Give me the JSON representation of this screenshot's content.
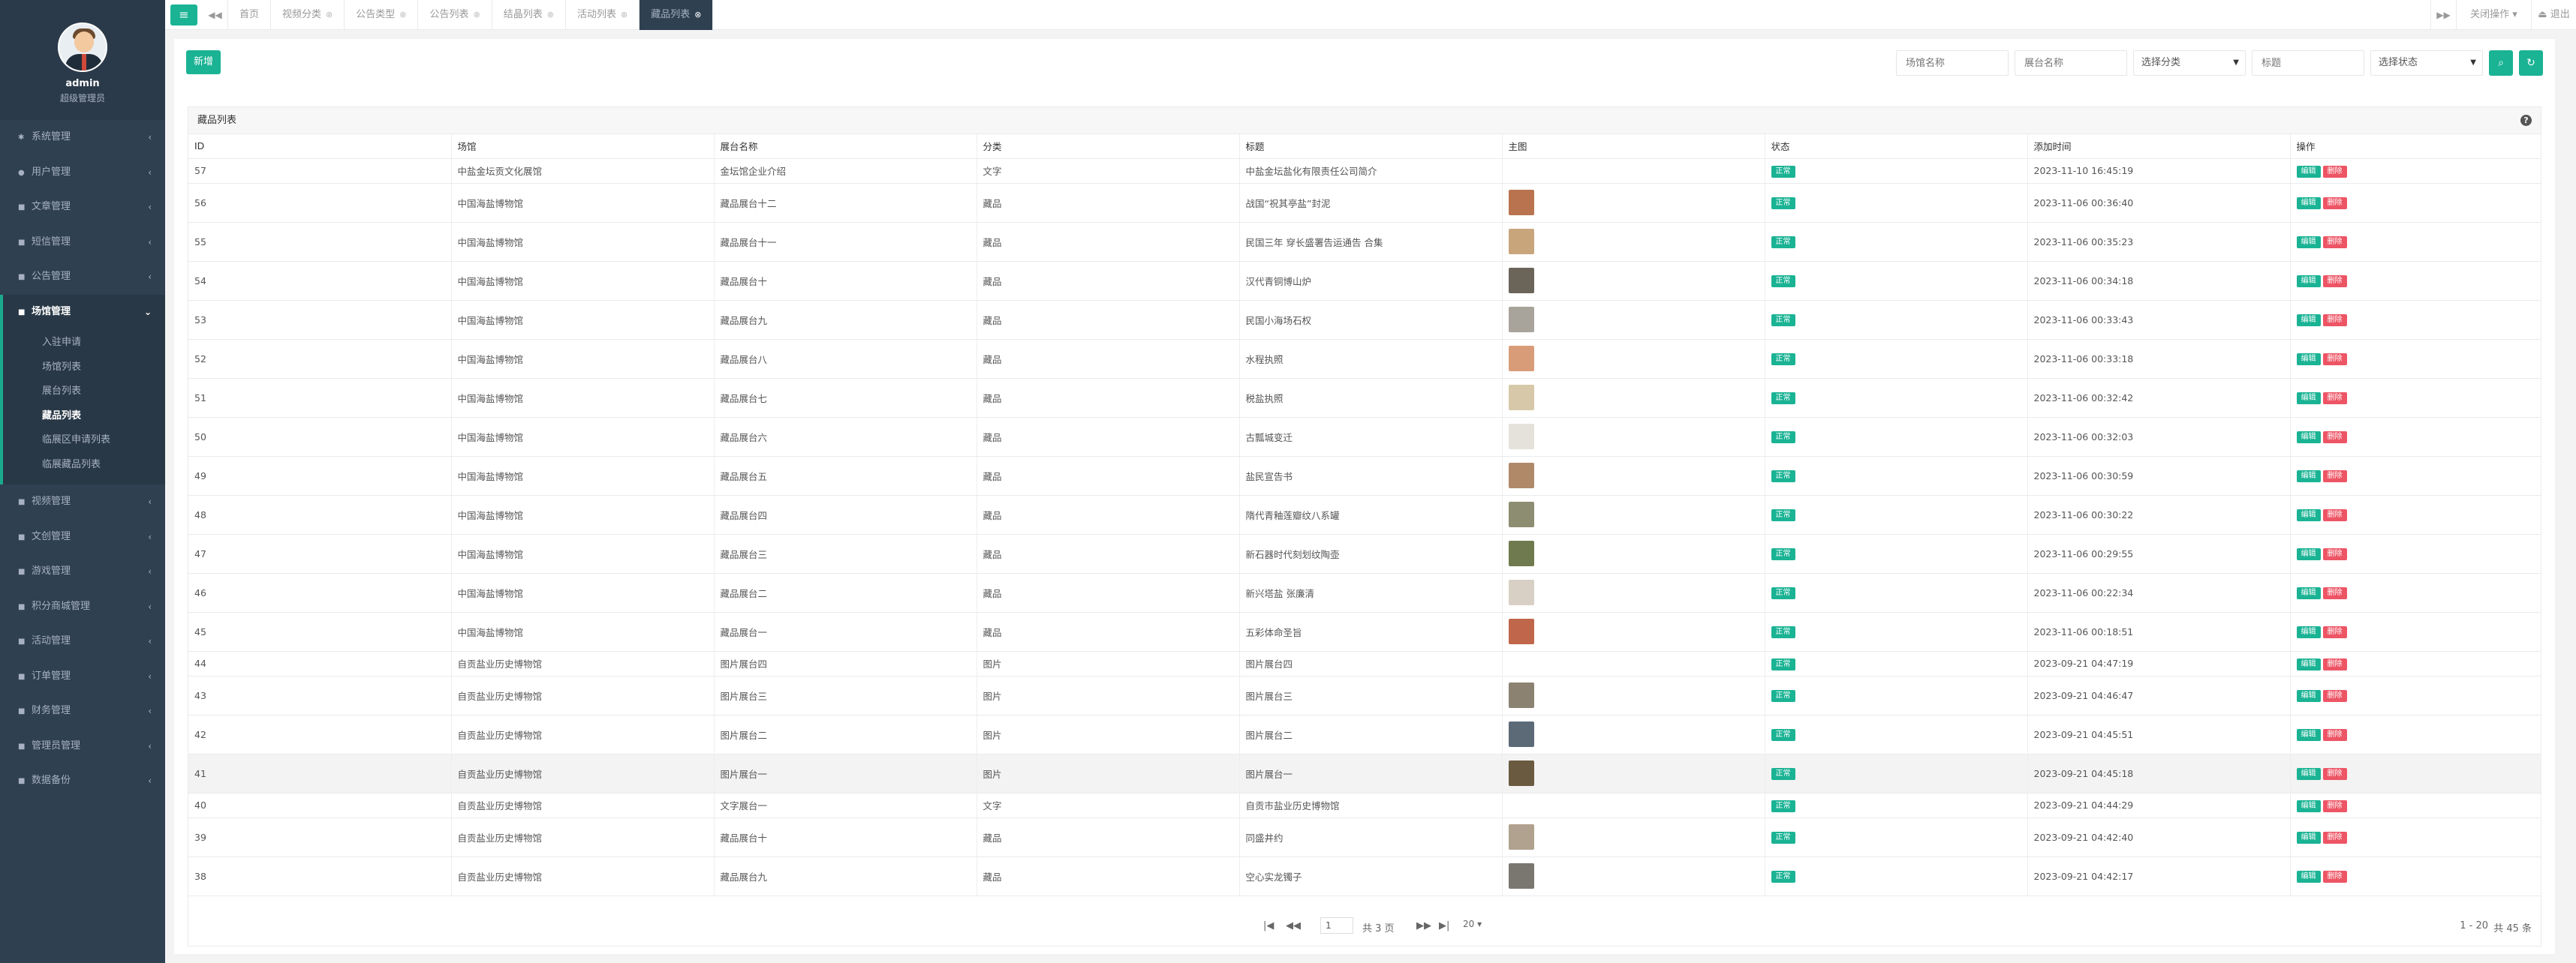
{
  "sidebar": {
    "user_name": "admin",
    "user_role": "超级管理员",
    "nav": [
      {
        "label": "系统管理",
        "icon": "gear-icon",
        "glyph": "✱"
      },
      {
        "label": "用户管理",
        "icon": "user-icon",
        "glyph": "●"
      },
      {
        "label": "文章管理",
        "icon": "folder-icon",
        "glyph": "■"
      },
      {
        "label": "短信管理",
        "icon": "folder-icon",
        "glyph": "■"
      },
      {
        "label": "公告管理",
        "icon": "folder-icon",
        "glyph": "■"
      },
      {
        "label": "场馆管理",
        "icon": "folder-icon",
        "glyph": "■"
      },
      {
        "label": "视频管理",
        "icon": "folder-icon",
        "glyph": "■"
      },
      {
        "label": "文创管理",
        "icon": "folder-icon",
        "glyph": "■"
      },
      {
        "label": "游戏管理",
        "icon": "folder-icon",
        "glyph": "■"
      },
      {
        "label": "积分商城管理",
        "icon": "folder-icon",
        "glyph": "■"
      },
      {
        "label": "活动管理",
        "icon": "folder-icon",
        "glyph": "■"
      },
      {
        "label": "订单管理",
        "icon": "folder-icon",
        "glyph": "■"
      },
      {
        "label": "财务管理",
        "icon": "folder-icon",
        "glyph": "■"
      },
      {
        "label": "管理员管理",
        "icon": "folder-icon",
        "glyph": "■"
      },
      {
        "label": "数据备份",
        "icon": "folder-icon",
        "glyph": "■"
      }
    ],
    "sub_items": [
      "入驻申请",
      "场馆列表",
      "展台列表",
      "藏品列表",
      "临展区申请列表",
      "临展藏品列表"
    ]
  },
  "topbar": {
    "tabs": [
      "首页",
      "视频分类",
      "公告类型",
      "公告列表",
      "结晶列表",
      "活动列表",
      "藏品列表"
    ],
    "close_ops": "关闭操作",
    "logout": "退出"
  },
  "toolbar": {
    "add_label": "新增",
    "venue_placeholder": "场馆名称",
    "booth_placeholder": "展台名称",
    "category_select": "选择分类",
    "title_placeholder": "标题",
    "status_select": "选择状态"
  },
  "panel": {
    "title": "藏品列表",
    "columns": [
      "ID",
      "场馆",
      "展台名称",
      "分类",
      "标题",
      "主图",
      "状态",
      "添加时间",
      "操作"
    ],
    "status_label": "正常",
    "edit_label": "编辑",
    "delete_label": "删除",
    "rows": [
      {
        "id": "57",
        "venue": "中盐金坛贡文化展馆",
        "booth": "金坛馆企业介绍",
        "category": "文字",
        "title": "中盐金坛盐化有限责任公司简介",
        "img": "",
        "time": "2023-11-10 16:45:19"
      },
      {
        "id": "56",
        "venue": "中国海盐博物馆",
        "booth": "藏品展台十二",
        "category": "藏品",
        "title": "战国“祝其亭盐”封泥",
        "img": "#b9744f",
        "time": "2023-11-06 00:36:40"
      },
      {
        "id": "55",
        "venue": "中国海盐博物馆",
        "booth": "藏品展台十一",
        "category": "藏品",
        "title": "民国三年 穿长盛署告运通告 合集",
        "img": "#c9a57c",
        "time": "2023-11-06 00:35:23"
      },
      {
        "id": "54",
        "venue": "中国海盐博物馆",
        "booth": "藏品展台十",
        "category": "藏品",
        "title": "汉代青铜博山炉",
        "img": "#6b6458",
        "time": "2023-11-06 00:34:18"
      },
      {
        "id": "53",
        "venue": "中国海盐博物馆",
        "booth": "藏品展台九",
        "category": "藏品",
        "title": "民国小海场石权",
        "img": "#a8a39b",
        "time": "2023-11-06 00:33:43"
      },
      {
        "id": "52",
        "venue": "中国海盐博物馆",
        "booth": "藏品展台八",
        "category": "藏品",
        "title": "水程执照",
        "img": "#d99c78",
        "time": "2023-11-06 00:33:18"
      },
      {
        "id": "51",
        "venue": "中国海盐博物馆",
        "booth": "藏品展台七",
        "category": "藏品",
        "title": "税盐执照",
        "img": "#d6c8a8",
        "time": "2023-11-06 00:32:42"
      },
      {
        "id": "50",
        "venue": "中国海盐博物馆",
        "booth": "藏品展台六",
        "category": "藏品",
        "title": "古瓢城变迁",
        "img": "#e5e2dc",
        "time": "2023-11-06 00:32:03"
      },
      {
        "id": "49",
        "venue": "中国海盐博物馆",
        "booth": "藏品展台五",
        "category": "藏品",
        "title": "盐民宣告书",
        "img": "#b08a68",
        "time": "2023-11-06 00:30:59"
      },
      {
        "id": "48",
        "venue": "中国海盐博物馆",
        "booth": "藏品展台四",
        "category": "藏品",
        "title": "隋代青釉莲瓣纹八系罐",
        "img": "#8d8d72",
        "time": "2023-11-06 00:30:22"
      },
      {
        "id": "47",
        "venue": "中国海盐博物馆",
        "booth": "藏品展台三",
        "category": "藏品",
        "title": "新石器时代刻划纹陶壶",
        "img": "#6f7a4e",
        "time": "2023-11-06 00:29:55"
      },
      {
        "id": "46",
        "venue": "中国海盐博物馆",
        "booth": "藏品展台二",
        "category": "藏品",
        "title": "新兴塔盐 张廉清",
        "img": "#d8d0c4",
        "time": "2023-11-06 00:22:34"
      },
      {
        "id": "45",
        "venue": "中国海盐博物馆",
        "booth": "藏品展台一",
        "category": "藏品",
        "title": "五彩体命圣旨",
        "img": "#c0664a",
        "time": "2023-11-06 00:18:51"
      },
      {
        "id": "44",
        "venue": "自贡盐业历史博物馆",
        "booth": "图片展台四",
        "category": "图片",
        "title": "图片展台四",
        "img": "",
        "time": "2023-09-21 04:47:19"
      },
      {
        "id": "43",
        "venue": "自贡盐业历史博物馆",
        "booth": "图片展台三",
        "category": "图片",
        "title": "图片展台三",
        "img": "#8c8272",
        "time": "2023-09-21 04:46:47"
      },
      {
        "id": "42",
        "venue": "自贡盐业历史博物馆",
        "booth": "图片展台二",
        "category": "图片",
        "title": "图片展台二",
        "img": "#5c6a78",
        "time": "2023-09-21 04:45:51"
      },
      {
        "id": "41",
        "venue": "自贡盐业历史博物馆",
        "booth": "图片展台一",
        "category": "图片",
        "title": "图片展台一",
        "img": "#6a5a40",
        "time": "2023-09-21 04:45:18"
      },
      {
        "id": "40",
        "venue": "自贡盐业历史博物馆",
        "booth": "文字展台一",
        "category": "文字",
        "title": "自贡市盐业历史博物馆",
        "img": "",
        "time": "2023-09-21 04:44:29"
      },
      {
        "id": "39",
        "venue": "自贡盐业历史博物馆",
        "booth": "藏品展台十",
        "category": "藏品",
        "title": "同盛井约",
        "img": "#b0a28e",
        "time": "2023-09-21 04:42:40"
      },
      {
        "id": "38",
        "venue": "自贡盐业历史博物馆",
        "booth": "藏品展台九",
        "category": "藏品",
        "title": "空心实龙镯子",
        "img": "#7a7670",
        "time": "2023-09-21 04:42:17"
      }
    ]
  },
  "pager": {
    "page": "1",
    "total_pages": "共 3 页",
    "page_size": "20",
    "range": "1 - 20",
    "total": "共 45 条"
  }
}
